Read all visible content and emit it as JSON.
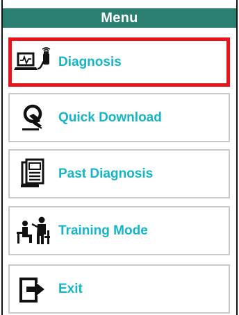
{
  "menu": {
    "title": "Menu",
    "items": [
      {
        "label": "Diagnosis",
        "icon": "diagnosis-laptop-icon",
        "selected": true
      },
      {
        "label": "Quick Download",
        "icon": "quick-download-icon",
        "selected": false
      },
      {
        "label": "Past Diagnosis",
        "icon": "past-diagnosis-document-icon",
        "selected": false
      },
      {
        "label": "Training Mode",
        "icon": "training-mode-icon",
        "selected": false
      },
      {
        "label": "Exit",
        "icon": "exit-icon",
        "selected": false
      }
    ]
  },
  "colors": {
    "title_bar": "#2a7f70",
    "title_text": "#ffffff",
    "label_text": "#14b5c8",
    "selected_border": "#e8141b",
    "item_border": "#c9c9c9"
  }
}
